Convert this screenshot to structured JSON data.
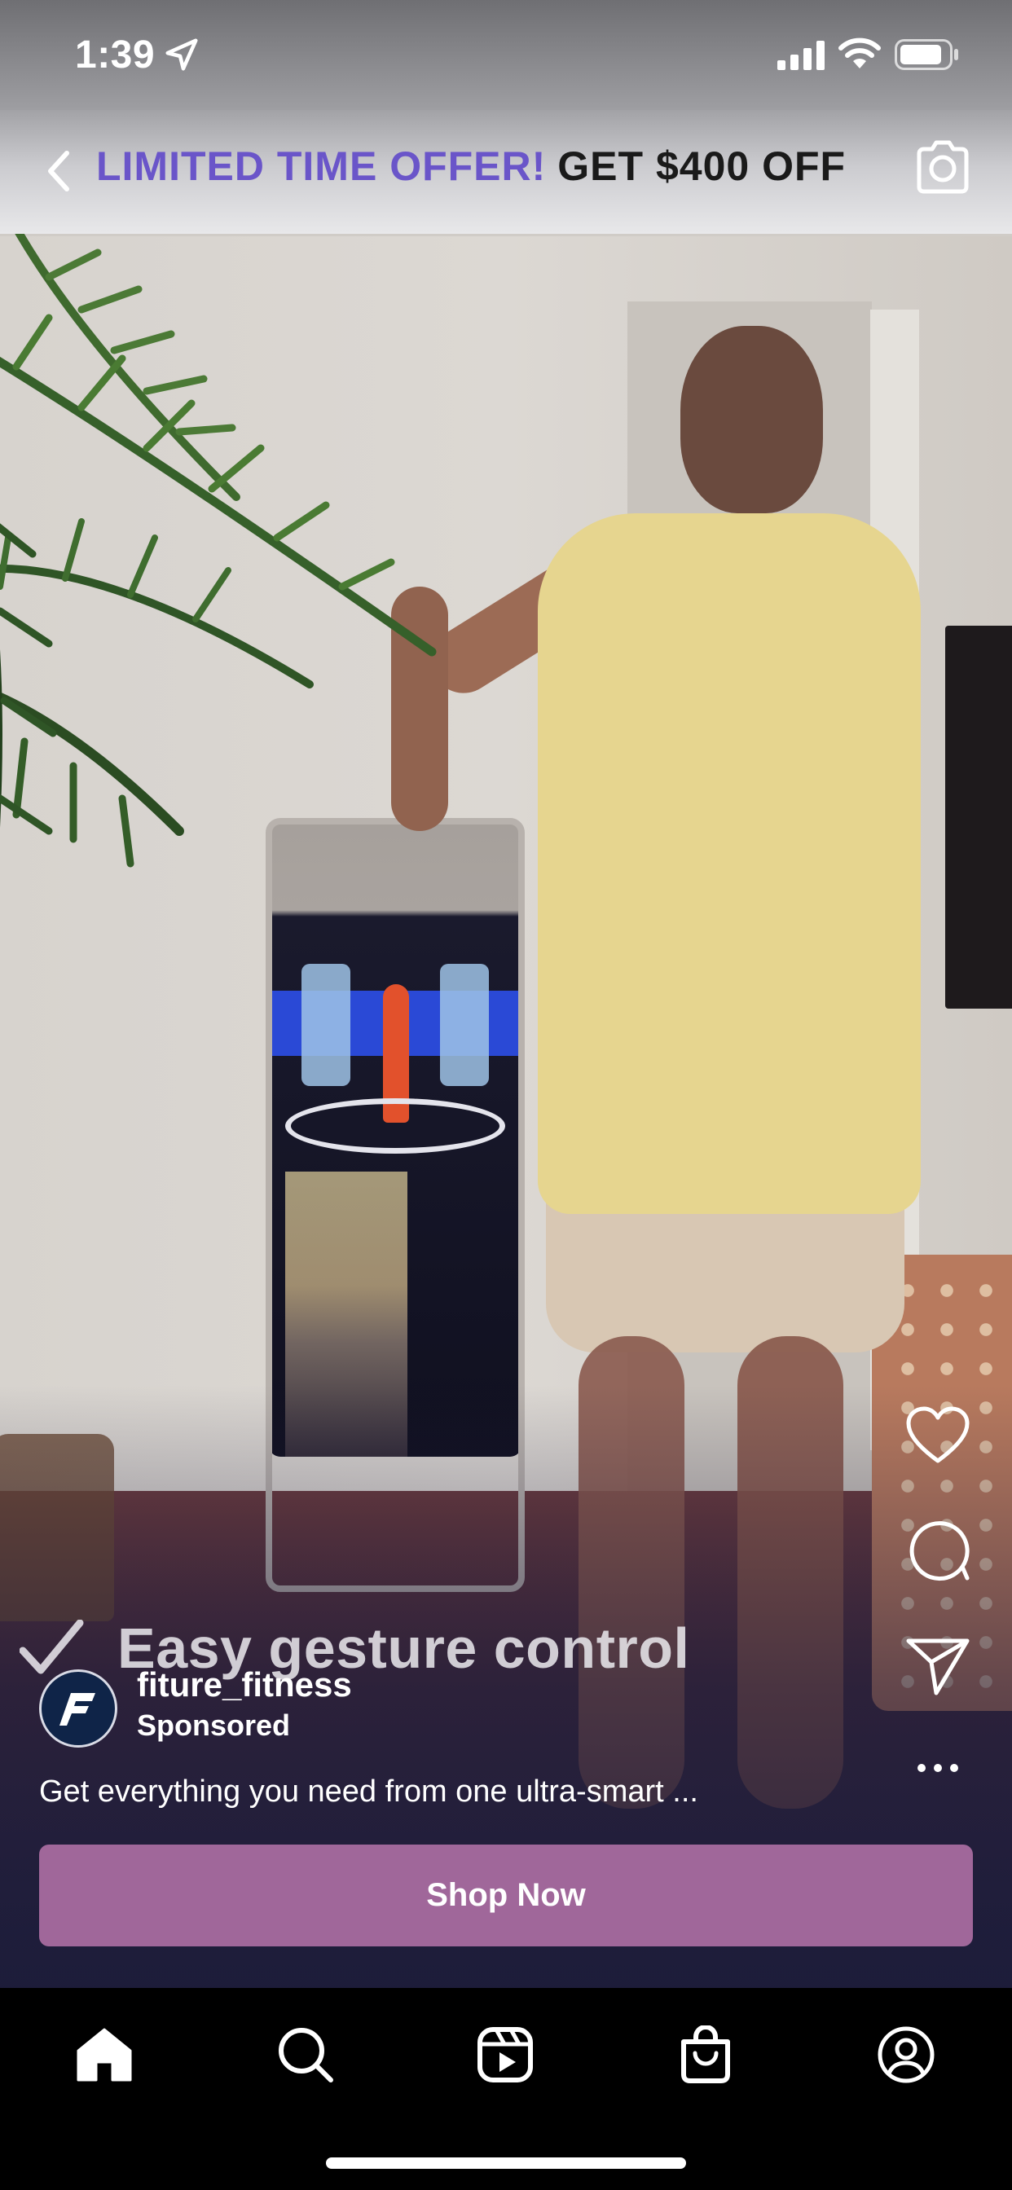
{
  "status_bar": {
    "time": "1:39",
    "icons": [
      "location-arrow-icon",
      "cellular-signal-icon",
      "wifi-icon",
      "battery-icon"
    ]
  },
  "offer_banner": {
    "highlight_text": "LIMITED TIME OFFER!",
    "offer_text": "GET $400 OFF",
    "highlight_color": "#6a55c9",
    "icons": [
      "chevron-left-icon",
      "camera-icon"
    ]
  },
  "video": {
    "caption": "Easy gesture control"
  },
  "post": {
    "account_name": "fiture_fitness",
    "label": "Sponsored",
    "description": "Get everything you need from one ultra-smart ...",
    "cta_label": "Shop Now",
    "cta_color": "#a0679a"
  },
  "actions": [
    "heart-icon",
    "comment-icon",
    "send-icon",
    "more-icon"
  ],
  "tab_bar": [
    "home-icon",
    "search-icon",
    "reels-icon",
    "shop-icon",
    "profile-icon"
  ]
}
